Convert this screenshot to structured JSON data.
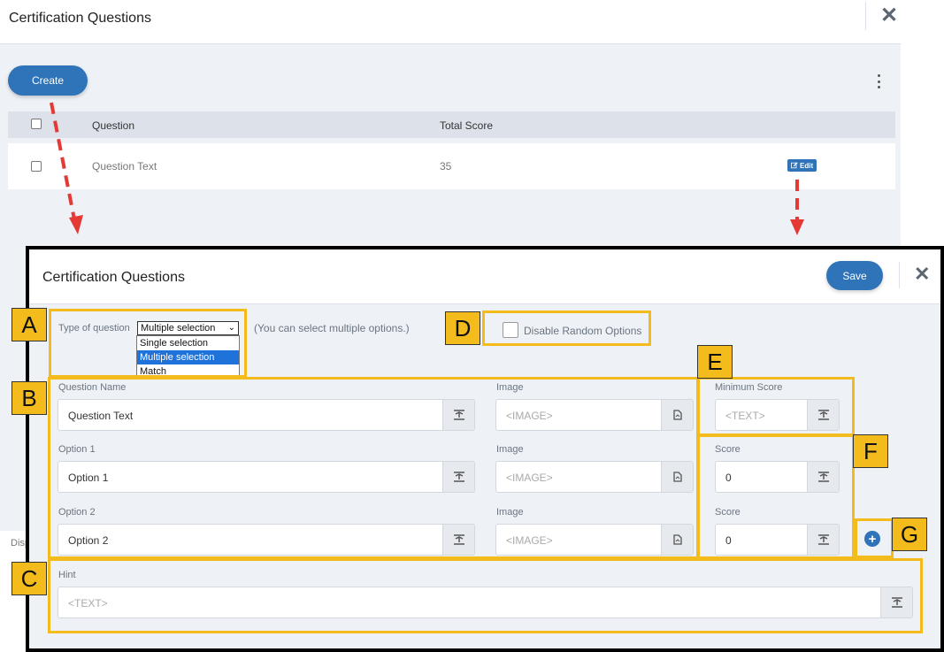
{
  "background_page": {
    "title": "Certification Questions",
    "create_label": "Create",
    "table": {
      "headers": [
        "Question",
        "Total Score"
      ],
      "rows": [
        {
          "question": "Question Text",
          "total_score": "35",
          "action": "Edit"
        }
      ]
    },
    "partial_text": "Disp"
  },
  "modal": {
    "title": "Certification Questions",
    "save_label": "Save",
    "type_of_question": {
      "label": "Type of question",
      "selected": "Multiple selection",
      "options": [
        "Single selection",
        "Multiple selection",
        "Match"
      ],
      "note": "(You can select multiple options.)"
    },
    "disable_random_label": "Disable Random Options",
    "question_name": {
      "label": "Question Name",
      "value": "Question Text"
    },
    "options": [
      {
        "label": "Option 1",
        "value": "Option 1",
        "score_label": "Score",
        "score": "0"
      },
      {
        "label": "Option 2",
        "value": "Option 2",
        "score_label": "Score",
        "score": "0"
      }
    ],
    "image_label": "Image",
    "image_placeholder": "<IMAGE>",
    "minimum_score": {
      "label": "Minimum Score",
      "placeholder": "<TEXT>"
    },
    "hint": {
      "label": "Hint",
      "placeholder": "<TEXT>"
    }
  },
  "annotations": {
    "letters": [
      "A",
      "B",
      "C",
      "D",
      "E",
      "F",
      "G"
    ],
    "box_color": "#f3bb1b",
    "arrow_color": "#e53935"
  },
  "colors": {
    "accent": "#2f73b8",
    "selected_option": "#1e72d9"
  },
  "icons": {
    "close": "close-icon",
    "kebab": "kebab-menu-icon",
    "translate": "text-format-icon",
    "image": "image-file-icon",
    "add": "plus-circle-icon",
    "edit": "edit-icon"
  }
}
